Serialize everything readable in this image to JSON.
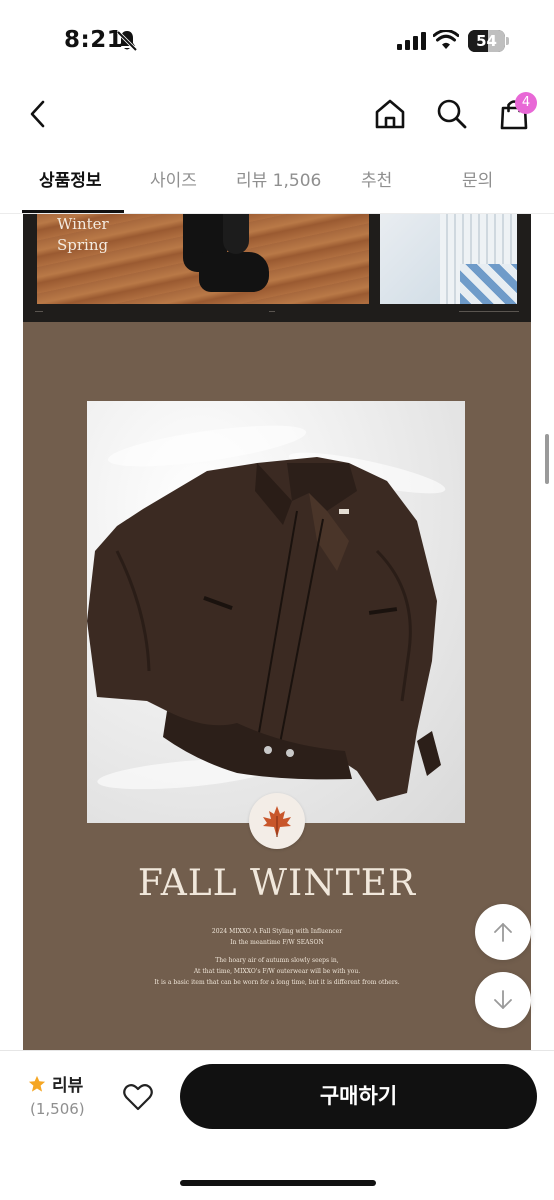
{
  "status_bar": {
    "time": "8:21",
    "battery": "54",
    "battery_level_percent": 54,
    "icons": [
      "bell-slash-icon",
      "cellular-signal-icon",
      "wifi-icon",
      "battery-icon"
    ]
  },
  "header": {
    "icons": [
      "chevron-left-icon",
      "home-icon",
      "search-icon",
      "shopping-bag-icon"
    ],
    "cart_count": "4",
    "badge_color": "#e868d6"
  },
  "tabs": [
    {
      "label": "상품정보",
      "active": true
    },
    {
      "label": "사이즈",
      "active": false
    },
    {
      "label": "리뷰 1,506",
      "active": false
    },
    {
      "label": "추천",
      "active": false
    },
    {
      "label": "문의",
      "active": false
    }
  ],
  "content": {
    "season_text": [
      "Winter",
      "Spring"
    ],
    "fall_title": "FALL WINTER",
    "fall_lines": [
      "2024 MIXXO A Fall Styling with Influencer",
      "In the meantime F/W SEASON",
      "The hoary air of autumn slowly seeps in,",
      "At that time, MIXXO's F/W outerwear will be with you.",
      "It is a basic item that can be worn for a long time, but it is different from others."
    ],
    "brand_label": "MIXXO",
    "page_bg_color": "#725e4d",
    "jacket_color": "#3b2a22"
  },
  "floating": {
    "icons": [
      "arrow-up-icon",
      "arrow-down-icon"
    ]
  },
  "bottom_bar": {
    "review_label": "리뷰",
    "review_count": "(1,506)",
    "buy_label": "구매하기",
    "star_color": "#f5a623",
    "icons": [
      "star-icon",
      "heart-outline-icon"
    ]
  }
}
